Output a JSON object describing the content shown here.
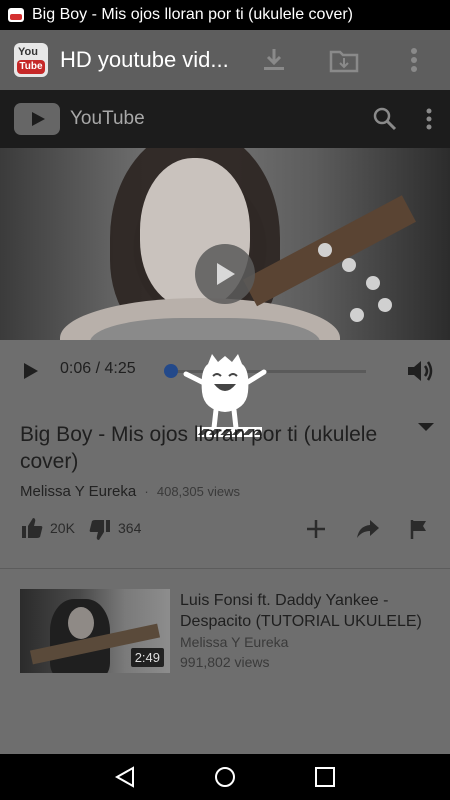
{
  "status_bar": {
    "title": "Big Boy - Mis ojos lloran por ti (ukulele cover)"
  },
  "app_toolbar": {
    "title": "HD youtube vid...",
    "icons": [
      "app-logo-icon",
      "download-icon",
      "folder-download-icon",
      "more-vert-icon"
    ]
  },
  "yt_header": {
    "name": "YouTube",
    "icons": [
      "youtube-logo-icon",
      "search-icon",
      "more-vert-icon"
    ]
  },
  "player": {
    "current_time": "0:06",
    "duration": "4:25",
    "time_text": "0:06 / 4:25",
    "progress_fraction": 0.024
  },
  "video": {
    "title": "Big Boy - Mis ojos lloran por ti (ukulele cover)",
    "channel": "Melissa Y Eureka",
    "separator": "·",
    "views": "408,305 views",
    "likes": "20K",
    "dislikes": "364"
  },
  "recommendations": [
    {
      "title": "Luis Fonsi ft. Daddy Yankee - Despacito (TUTORIAL UKULELE)",
      "channel": "Melissa Y Eureka",
      "views": "991,802 views",
      "duration": "2:49"
    }
  ],
  "colors": {
    "accent": "#23498a",
    "toolbar": "#5e5e5e",
    "dim": "#6e6e6e"
  }
}
